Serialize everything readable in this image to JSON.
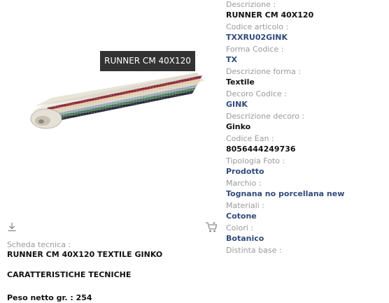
{
  "image": {
    "tooltip": "RUNNER CM 40X120",
    "rug_colors": [
      "#2b2b3a",
      "#4e7c5a",
      "#9aa8b3",
      "#d9d4c8",
      "#e8c9a8",
      "#8a2d3a"
    ]
  },
  "icons": {
    "download": "download-icon",
    "cart": "cart-icon"
  },
  "tech_sheet": {
    "label": "Scheda tecnica :",
    "title": "RUNNER CM 40X120 TEXTILE GINKO",
    "section": "CARATTERISTICHE TECNICHE",
    "weight": "Peso netto gr. : 254"
  },
  "specs": [
    {
      "label": "Descrizione :",
      "value": "RUNNER CM 40X120",
      "style": "dark"
    },
    {
      "label": "Codice articolo :",
      "value": "TXXRU02GINK",
      "style": "link"
    },
    {
      "label": "Forma Codice :",
      "value": "TX",
      "style": "link"
    },
    {
      "label": "Descrizione forma :",
      "value": "Textile",
      "style": "dark"
    },
    {
      "label": "Decoro Codice :",
      "value": "GINK",
      "style": "link"
    },
    {
      "label": "Descrizione decoro :",
      "value": "Ginko",
      "style": "dark"
    },
    {
      "label": "Codice Ean :",
      "value": "8056444249736",
      "style": "dark"
    },
    {
      "label": "Tipologia Foto :",
      "value": "Prodotto",
      "style": "link"
    },
    {
      "label": "Marchio :",
      "value": "Tognana no porcellana new",
      "style": "link"
    },
    {
      "label": "Materiali :",
      "value": "Cotone",
      "style": "link"
    },
    {
      "label": "Colori :",
      "value": "Botanico",
      "style": "link"
    },
    {
      "label": "Distinta base :",
      "value": "",
      "style": "dark"
    }
  ]
}
